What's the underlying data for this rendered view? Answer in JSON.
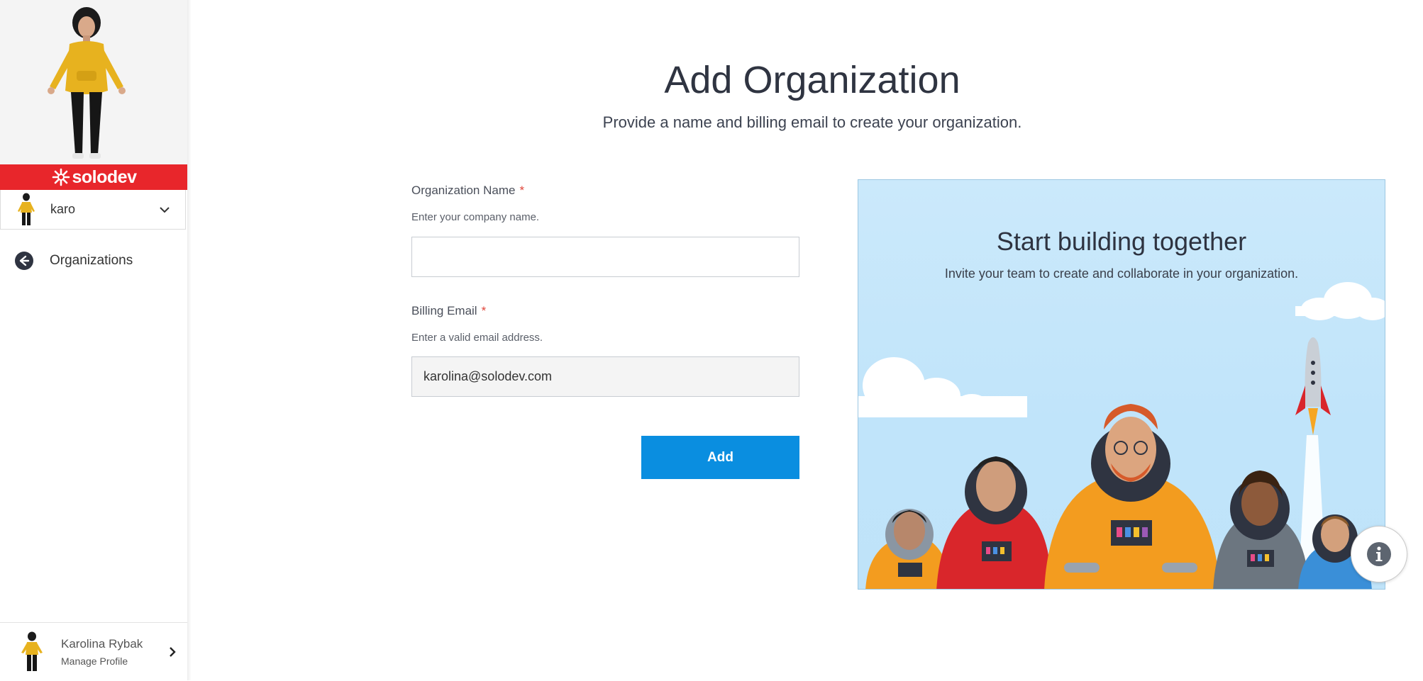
{
  "sidebar": {
    "brand_name": "solodev",
    "user_select": {
      "name": "karo"
    },
    "nav": {
      "back_label": "Organizations"
    },
    "profile": {
      "name": "Karolina Rybak",
      "sub": "Manage Profile"
    }
  },
  "main": {
    "title": "Add Organization",
    "subtitle": "Provide a name and billing email to create your organization.",
    "org_name": {
      "label": "Organization Name",
      "required_mark": "*",
      "hint": "Enter your company name.",
      "value": ""
    },
    "billing_email": {
      "label": "Billing Email",
      "required_mark": "*",
      "hint": "Enter a valid email address.",
      "value": "karolina@solodev.com"
    },
    "add_label": "Add"
  },
  "promo": {
    "title": "Start building together",
    "text": "Invite your team to create and collaborate in your organization."
  },
  "colors": {
    "brand_red": "#e8262b",
    "primary_blue": "#0a8ee0",
    "required_red": "#e0453a",
    "sky": "#c0e4fa"
  },
  "icons": {
    "brand": "solodev-flower-icon",
    "dropdown": "chevron-down-icon",
    "back": "arrow-left-circle-icon",
    "profile_nav": "chevron-right-icon",
    "info": "info-circle-icon"
  }
}
